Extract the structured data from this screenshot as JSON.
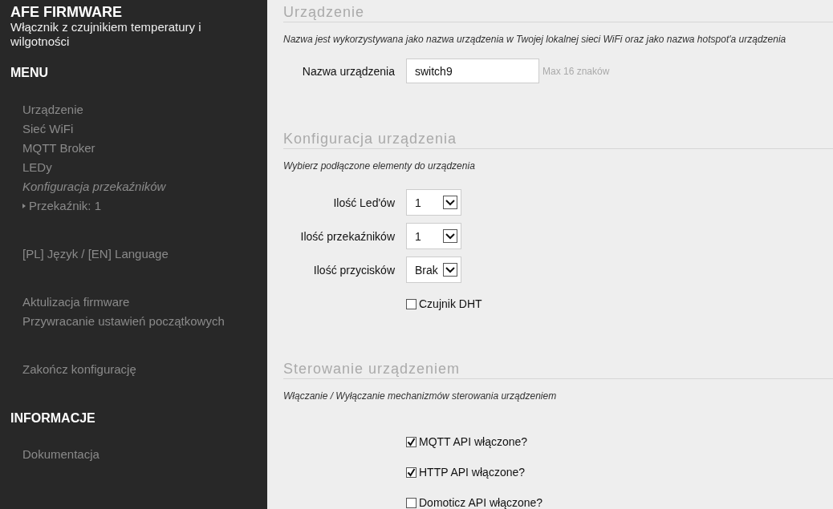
{
  "sidebar": {
    "title": "AFE FIRMWARE",
    "subtitle": "Włącznik z czujnikiem temperatury i wilgotności",
    "sections": [
      {
        "heading": "MENU",
        "groups": [
          {
            "items": [
              {
                "label": "Urządzenie",
                "kind": "link"
              },
              {
                "label": "Sieć WiFi",
                "kind": "link"
              },
              {
                "label": "MQTT Broker",
                "kind": "link"
              },
              {
                "label": "LEDy",
                "kind": "link"
              },
              {
                "label": "Konfiguracja przekaźników",
                "kind": "group"
              },
              {
                "label": "Przekaźnik: 1",
                "kind": "sub"
              }
            ]
          },
          {
            "items": [
              {
                "label": "[PL] Język / [EN] Language",
                "kind": "link"
              }
            ]
          },
          {
            "items": [
              {
                "label": "Aktulizacja firmware",
                "kind": "link"
              },
              {
                "label": "Przywracanie ustawień początkowych",
                "kind": "link"
              }
            ]
          },
          {
            "items": [
              {
                "label": "Zakończ konfigurację",
                "kind": "link"
              }
            ]
          }
        ]
      },
      {
        "heading": "INFORMACJE",
        "groups": [
          {
            "items": [
              {
                "label": "Dokumentacja",
                "kind": "link"
              }
            ]
          }
        ]
      }
    ]
  },
  "sections": [
    {
      "title": "Urządzenie",
      "description": "Nazwa jest wykorzystywana jako nazwa urządzenia w Twojej lokalnej sieci WiFi oraz jako nazwa hotspot'a urządzenia",
      "fields": [
        {
          "kind": "text",
          "label": "Nazwa urządzenia",
          "value": "switch9",
          "hint": "Max 16 znaków"
        }
      ]
    },
    {
      "title": "Konfiguracja urządzenia",
      "description": "Wybierz podłączone elementy do urządzenia",
      "fields": [
        {
          "kind": "select",
          "label": "Ilość Led'ów",
          "value": "1"
        },
        {
          "kind": "select",
          "label": "Ilość przekaźników",
          "value": "1"
        },
        {
          "kind": "select",
          "label": "Ilość przycisków",
          "value": "Brak"
        },
        {
          "kind": "checkbox",
          "label": "Czujnik DHT",
          "checked": false
        }
      ]
    },
    {
      "title": "Sterowanie urządzeniem",
      "description": "Włączanie / Wyłączanie mechanizmów sterowania urządzeniem",
      "fields": [
        {
          "kind": "checkbox",
          "label": "MQTT API włączone?",
          "checked": true
        },
        {
          "kind": "checkbox",
          "label": "HTTP API włączone?",
          "checked": true
        },
        {
          "kind": "checkbox",
          "label": "Domoticz API włączone?",
          "checked": false
        }
      ]
    }
  ]
}
